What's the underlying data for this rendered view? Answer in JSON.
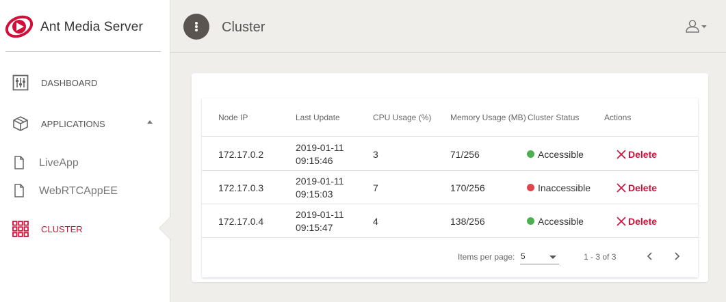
{
  "brand": {
    "name": "Ant Media Server",
    "logo_color": "#d0103a"
  },
  "sidebar": {
    "items": [
      {
        "label": "DASHBOARD",
        "icon": "dashboard-sliders-icon"
      },
      {
        "label": "APPLICATIONS",
        "icon": "cube-icon"
      },
      {
        "label": "LiveApp",
        "icon": "file-icon"
      },
      {
        "label": "WebRTCAppEE",
        "icon": "file-icon"
      },
      {
        "label": "CLUSTER",
        "icon": "grid-icon",
        "active": true
      }
    ]
  },
  "header": {
    "title": "Cluster",
    "menu_icon": "more-vertical-icon",
    "user_icon": "user-icon"
  },
  "table": {
    "columns": [
      "Node IP",
      "Last Update",
      "CPU Usage (%)",
      "Memory Usage (MB)",
      "Cluster Status",
      "Actions"
    ],
    "rows": [
      {
        "ip": "172.17.0.2",
        "date": "2019-01-11",
        "time": "09:15:46",
        "cpu": "3",
        "memory": "71/256",
        "status": "Accessible",
        "status_color": "#4caf50",
        "action": "Delete"
      },
      {
        "ip": "172.17.0.3",
        "date": "2019-01-11",
        "time": "09:15:03",
        "cpu": "7",
        "memory": "170/256",
        "status": "Inaccessible",
        "status_color": "#e0474c",
        "action": "Delete"
      },
      {
        "ip": "172.17.0.4",
        "date": "2019-01-11",
        "time": "09:15:47",
        "cpu": "4",
        "memory": "138/256",
        "status": "Accessible",
        "status_color": "#4caf50",
        "action": "Delete"
      }
    ]
  },
  "pagination": {
    "items_per_page_label": "Items per page:",
    "items_per_page": "5",
    "range": "1 - 3 of 3"
  },
  "colors": {
    "accent": "#d0103a",
    "ok": "#4caf50",
    "error": "#e0474c",
    "background": "#f0eeeb"
  }
}
